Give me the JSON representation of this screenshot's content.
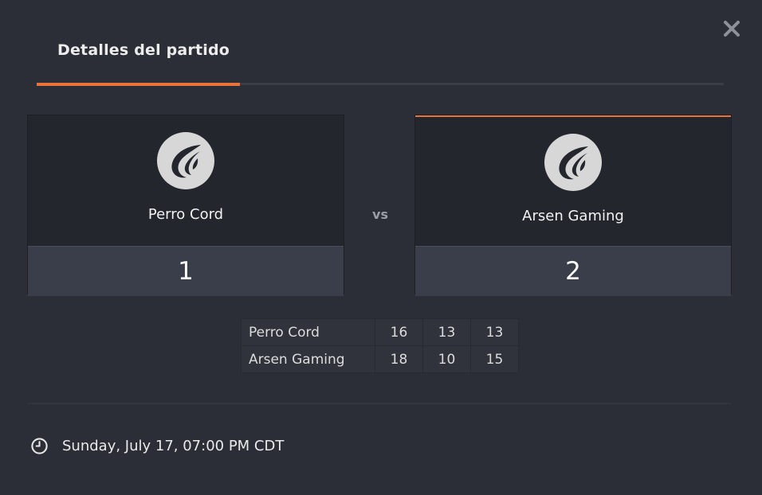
{
  "dialog": {
    "tab_label": "Detalles del partido",
    "vs_label": "vs",
    "accent_color": "#e8723a"
  },
  "teams": [
    {
      "name": "Perro Cord",
      "score": "1",
      "logo_icon": "team-logo-icon",
      "winner": false
    },
    {
      "name": "Arsen Gaming",
      "score": "2",
      "logo_icon": "team-logo-icon",
      "winner": true
    }
  ],
  "map_scores": {
    "rows": [
      {
        "team": "Perro Cord",
        "scores": [
          "16",
          "13",
          "13"
        ]
      },
      {
        "team": "Arsen Gaming",
        "scores": [
          "18",
          "10",
          "15"
        ]
      }
    ]
  },
  "match_time": {
    "icon": "clock-icon",
    "text": "Sunday, July 17, 07:00 PM CDT"
  },
  "icons": {
    "close": "close-icon"
  }
}
